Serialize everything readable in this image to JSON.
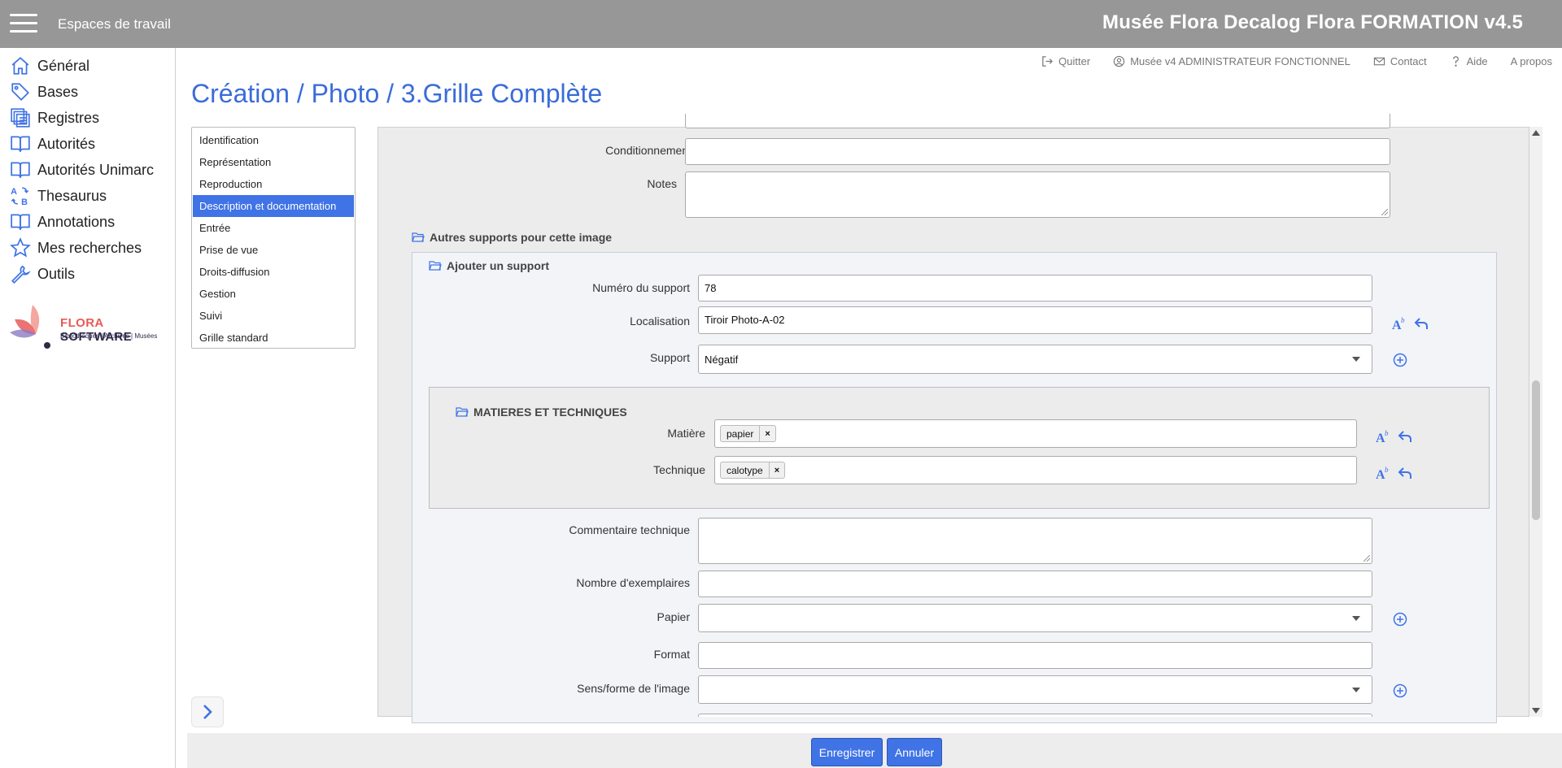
{
  "topbar": {
    "workspaces_label": "Espaces de travail",
    "app_title": "Musée Flora Decalog Flora FORMATION v4.5"
  },
  "sidebar": {
    "items": [
      {
        "label": "Général",
        "icon": "home-icon"
      },
      {
        "label": "Bases",
        "icon": "tag-icon"
      },
      {
        "label": "Registres",
        "icon": "registers-icon"
      },
      {
        "label": "Autorités",
        "icon": "book-icon"
      },
      {
        "label": "Autorités Unimarc",
        "icon": "book-icon"
      },
      {
        "label": "Thesaurus",
        "icon": "thesaurus-icon"
      },
      {
        "label": "Annotations",
        "icon": "book-icon"
      },
      {
        "label": "Mes recherches",
        "icon": "star-icon"
      },
      {
        "label": "Outils",
        "icon": "wrench-icon"
      }
    ],
    "logo": {
      "brand_a": "FLORA",
      "brand_b": " SOFTWARE",
      "tagline": "Bibliothèques | Archives | Musées"
    }
  },
  "utility": {
    "quit": "Quitter",
    "user": "Musée v4 ADMINISTRATEUR FONCTIONNEL",
    "contact": "Contact",
    "help": "Aide",
    "about": "A propos"
  },
  "page_title": "Création / Photo / 3.Grille Complète",
  "sections": [
    "Identification",
    "Représentation",
    "Reproduction",
    "Description et documentation",
    "Entrée",
    "Prise de vue",
    "Droits-diffusion",
    "Gestion",
    "Suivi",
    "Grille standard"
  ],
  "active_section": "Description et documentation",
  "form": {
    "conditionnement_label": "Conditionnement",
    "notes_label": "Notes",
    "other_supports_title": "Autres supports pour cette image",
    "add_support_title": "Ajouter un support",
    "numero_label": "Numéro du support",
    "numero_value": "78",
    "localisation_label": "Localisation",
    "localisation_value": "Tiroir Photo-A-02",
    "support_label": "Support",
    "support_value": "Négatif",
    "matieres_title": "MATIERES ET TECHNIQUES",
    "matiere_label": "Matière",
    "matiere_tag": "papier",
    "technique_label": "Technique",
    "technique_tag": "calotype",
    "commentaire_label": "Commentaire technique",
    "exemplaires_label": "Nombre d'exemplaires",
    "papier_label": "Papier",
    "format_label": "Format",
    "sens_label": "Sens/forme de l'image"
  },
  "buttons": {
    "save": "Enregistrer",
    "cancel": "Annuler"
  },
  "colors": {
    "accent": "#3f73e6",
    "title": "#3b6cd8",
    "topbar": "#979797"
  }
}
